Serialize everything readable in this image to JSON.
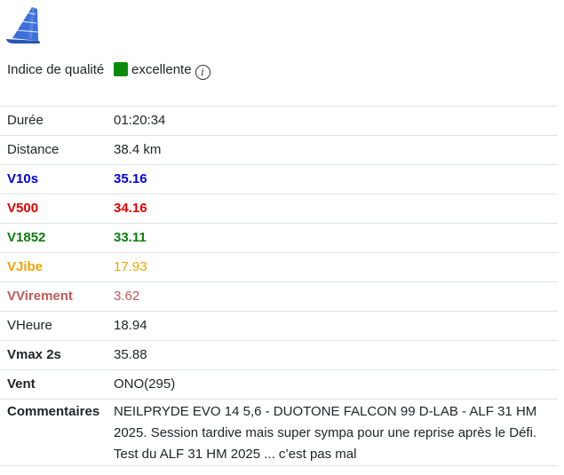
{
  "colors": {
    "v10s": "#0000e6",
    "v500": "#e60000",
    "v1852": "#0a7d0a",
    "vjibe": "#f0a500",
    "virement": "#c05a5a",
    "quality": "#0a8a0a",
    "logo": "#3b6fd9"
  },
  "icons": {
    "logo": "windsurf-sail-icon",
    "info": "info-icon"
  },
  "rows": {
    "quality": {
      "label": "Indice de qualité",
      "value": "excellente"
    },
    "duration": {
      "label": "Durée",
      "value": "01:20:34"
    },
    "distance": {
      "label": "Distance",
      "value": "38.4 km"
    },
    "v10s": {
      "label": "V10s",
      "value": "35.16"
    },
    "v500": {
      "label": "V500",
      "value": "34.16"
    },
    "v1852": {
      "label": "V1852",
      "value": "33.11"
    },
    "vjibe": {
      "label": "VJibe",
      "value": "17.93"
    },
    "virement": {
      "label": "VVirement",
      "value": "3.62"
    },
    "vheure": {
      "label": "VHeure",
      "value": "18.94"
    },
    "vmax2s": {
      "label": "Vmax 2s",
      "value": "35.88"
    },
    "vent": {
      "label": "Vent",
      "value": "ONO(295)"
    },
    "comments": {
      "label": "Commentaires",
      "value": "NEILPRYDE EVO 14 5,6 - DUOTONE FALCON 99 D-LAB - ALF 31 HM 2025. Session tardive mais super sympa pour une reprise après le Défi. Test du ALF 31 HM 2025 ... c’est pas mal"
    }
  }
}
